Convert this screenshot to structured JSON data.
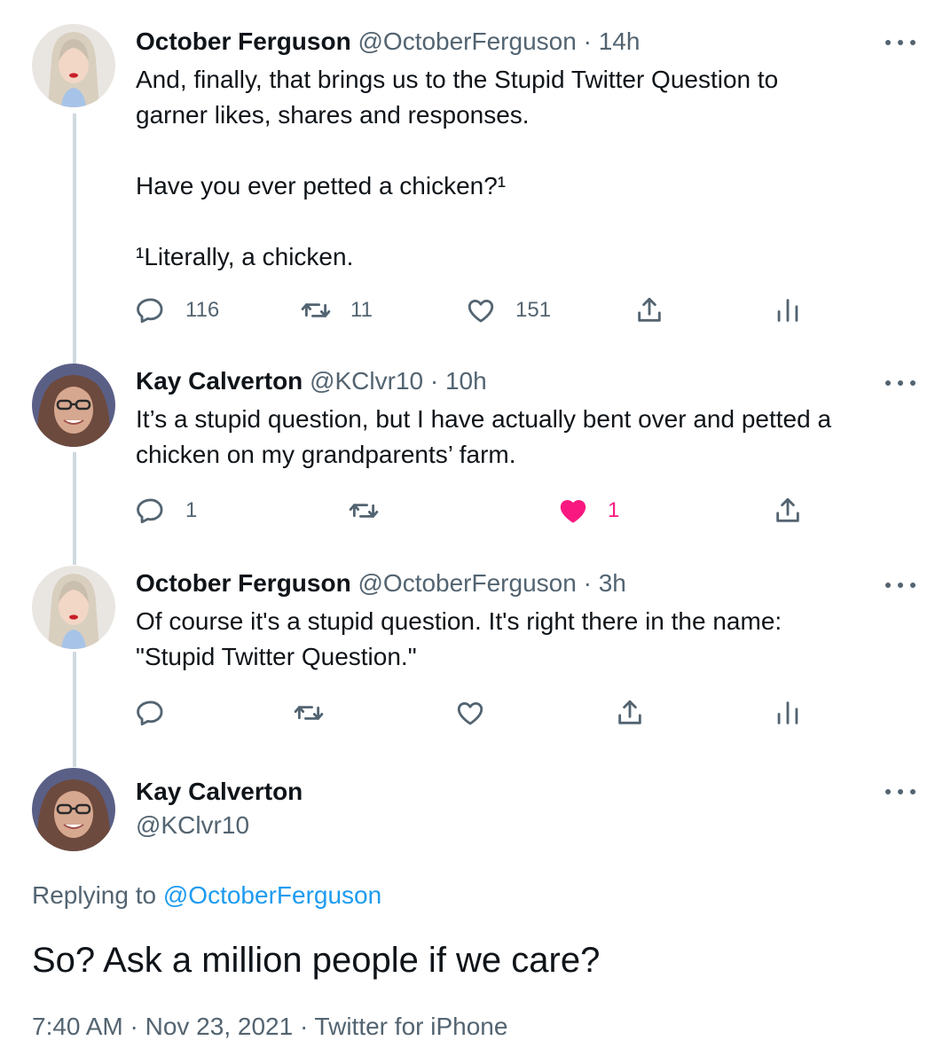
{
  "tweets": [
    {
      "name": "October Ferguson",
      "handle": "@OctoberFerguson",
      "time": "14h",
      "text": "And, finally, that brings us to the Stupid Twitter Question to\ngarner likes, shares and responses.\n\nHave you ever petted a chicken?¹\n\n¹Literally, a chicken.",
      "replies": "116",
      "retweets": "11",
      "likes": "151",
      "liked": false,
      "show_analytics": true
    },
    {
      "name": "Kay Calverton",
      "handle": "@KClvr10",
      "time": "10h",
      "text": "It’s a stupid question, but I have actually bent over and petted a\nchicken on my grandparents’ farm.",
      "replies": "1",
      "retweets": "",
      "likes": "1",
      "liked": true,
      "show_analytics": false
    },
    {
      "name": "October Ferguson",
      "handle": "@OctoberFerguson",
      "time": "3h",
      "text": "Of course it's a stupid question. It's right there in the name:\n\"Stupid Twitter Question.\"",
      "replies": "",
      "retweets": "",
      "likes": "",
      "liked": false,
      "show_analytics": true
    }
  ],
  "main_tweet": {
    "name": "Kay Calverton",
    "handle": "@KClvr10",
    "replying_prefix": "Replying to",
    "replying_to": "@OctoberFerguson",
    "text": "So? Ask a million people if we care?",
    "meta": "7:40 AM · Nov 23, 2021 · Twitter for iPhone"
  },
  "separator": "·",
  "colors": {
    "text": "#0f1419",
    "secondary": "#536471",
    "link": "#1d9bf0",
    "like": "#f91880",
    "thread_line": "#cfd9de"
  },
  "icons": [
    "reply-icon",
    "retweet-icon",
    "like-icon",
    "share-icon",
    "analytics-icon",
    "more-icon"
  ]
}
